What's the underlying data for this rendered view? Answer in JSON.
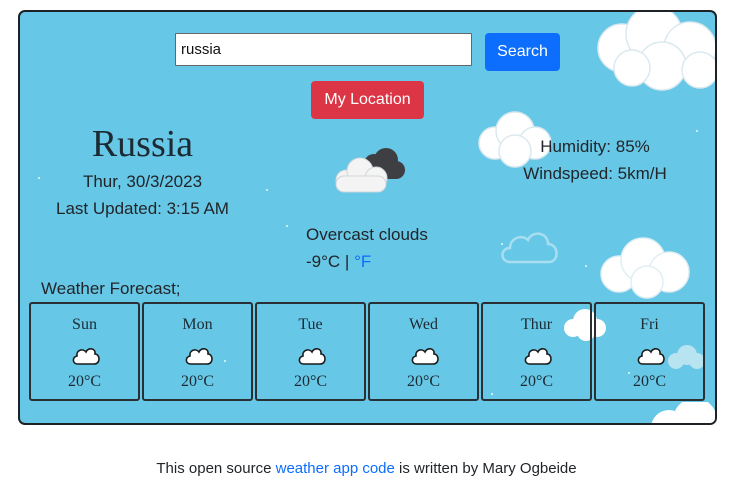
{
  "search": {
    "value": "russia",
    "button_label": "Search"
  },
  "location_button": {
    "label": "My Location"
  },
  "current": {
    "city": "Russia",
    "date": "Thur, 30/3/2023",
    "last_updated": "Last Updated: 3:15 AM",
    "description": "Overcast clouds",
    "temperature": "-9°C",
    "separator": " | ",
    "alt_unit": "°F",
    "humidity": "Humidity: 85%",
    "windspeed": "Windspeed: 5km/H",
    "icon": "overcast-clouds-icon"
  },
  "forecast": {
    "title": "Weather Forecast;",
    "days": [
      {
        "day": "Sun",
        "temp": "20°C",
        "icon": "cloud-icon"
      },
      {
        "day": "Mon",
        "temp": "20°C",
        "icon": "cloud-icon"
      },
      {
        "day": "Tue",
        "temp": "20°C",
        "icon": "cloud-icon"
      },
      {
        "day": "Wed",
        "temp": "20°C",
        "icon": "cloud-icon"
      },
      {
        "day": "Thur",
        "temp": "20°C",
        "icon": "cloud-icon"
      },
      {
        "day": "Fri",
        "temp": "20°C",
        "icon": "cloud-icon"
      }
    ]
  },
  "footer": {
    "prefix": "This open source ",
    "link": "weather app code",
    "suffix": " is written by Mary Ogbeide"
  },
  "colors": {
    "background": "#67c7e6",
    "search_button": "#0d6efd",
    "location_button": "#dc3545",
    "link": "#0d6efd"
  }
}
